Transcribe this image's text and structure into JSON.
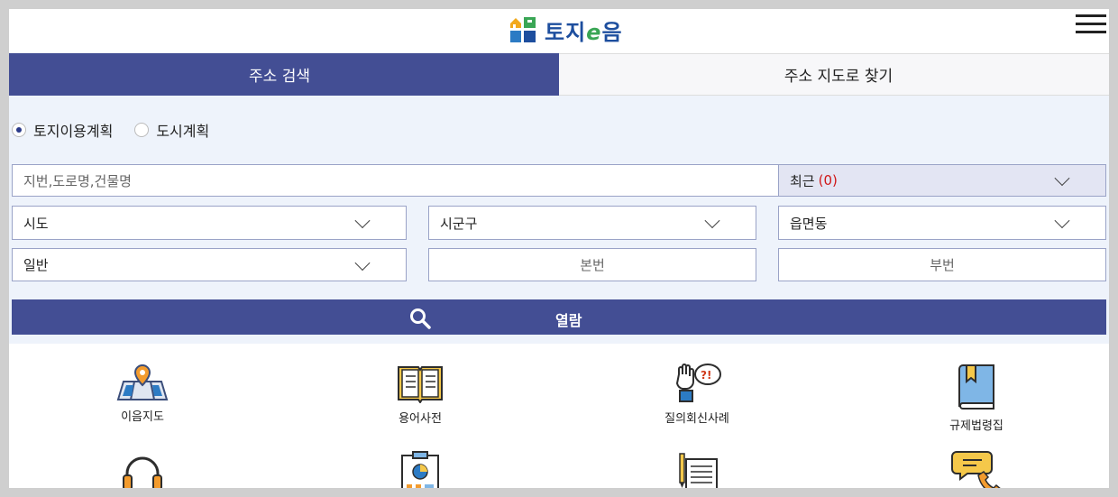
{
  "header": {
    "logo_text_a": "토지",
    "logo_text_e": "e",
    "logo_text_b": "음",
    "menu_icon": "hamburger-menu-icon"
  },
  "tabs": [
    {
      "label": "주소 검색",
      "active": true
    },
    {
      "label": "주소 지도로 찾기",
      "active": false
    }
  ],
  "plan_type": {
    "options": [
      {
        "label": "토지이용계획",
        "selected": true
      },
      {
        "label": "도시계획",
        "selected": false
      }
    ]
  },
  "search": {
    "placeholder": "지번,도로명,건물명",
    "recent_label": "최근",
    "recent_count": "(0)"
  },
  "selects": {
    "sido": "시도",
    "sigungu": "시군구",
    "eupmyeondong": "읍면동",
    "land_type": "일반"
  },
  "lot_number": {
    "main_placeholder": "본번",
    "sub_placeholder": "부번"
  },
  "view_button": {
    "label": "열람",
    "icon": "search-icon"
  },
  "quick_links": [
    {
      "label": "이음지도",
      "icon": "map-pin-icon"
    },
    {
      "label": "용어사전",
      "icon": "book-icon"
    },
    {
      "label": "질의회신사례",
      "icon": "question-hand-icon"
    },
    {
      "label": "규제법령집",
      "icon": "bookmark-book-icon"
    },
    {
      "label": "",
      "icon": "headset-icon"
    },
    {
      "label": "",
      "icon": "clipboard-chart-icon"
    },
    {
      "label": "",
      "icon": "document-pencil-icon"
    },
    {
      "label": "",
      "icon": "chat-phone-icon"
    }
  ],
  "colors": {
    "primary": "#434e94",
    "panel_bg": "#eef3fb",
    "accent_red": "#d01818"
  }
}
